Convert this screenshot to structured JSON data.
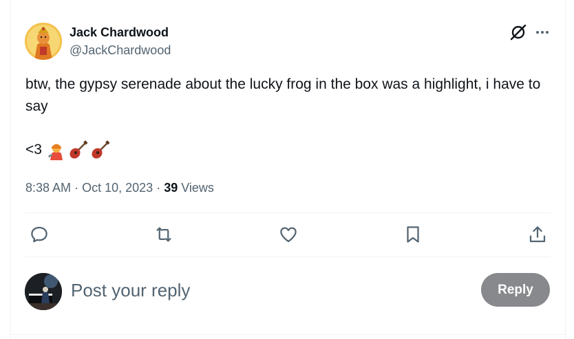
{
  "author": {
    "name": "Jack Chardwood",
    "handle": "@JackChardwood",
    "avatar_icon": "hanuman-avatar"
  },
  "header_actions": {
    "grok_icon": "grok-icon",
    "more_icon": "more-dots-icon"
  },
  "tweet": {
    "text": "btw, the gypsy serenade about the lucky frog in the box was a highlight, i have to say",
    "line2": "<3",
    "emojis": [
      "singer-emoji",
      "guitar-emoji",
      "guitar-emoji"
    ]
  },
  "meta": {
    "time": "8:38 AM",
    "separator": "·",
    "date": "Oct 10, 2023",
    "views_count": "39",
    "views_label": "Views"
  },
  "actions": [
    {
      "icon": "reply-icon"
    },
    {
      "icon": "retweet-icon"
    },
    {
      "icon": "like-icon"
    },
    {
      "icon": "bookmark-icon"
    },
    {
      "icon": "share-icon"
    }
  ],
  "reply_box": {
    "placeholder": "Post your reply",
    "button_label": "Reply",
    "avatar_icon": "pianist-avatar"
  },
  "colors": {
    "text_primary": "#0f1419",
    "text_secondary": "#536471",
    "reply_button_bg": "#87898c",
    "divider": "#eff3f4"
  }
}
